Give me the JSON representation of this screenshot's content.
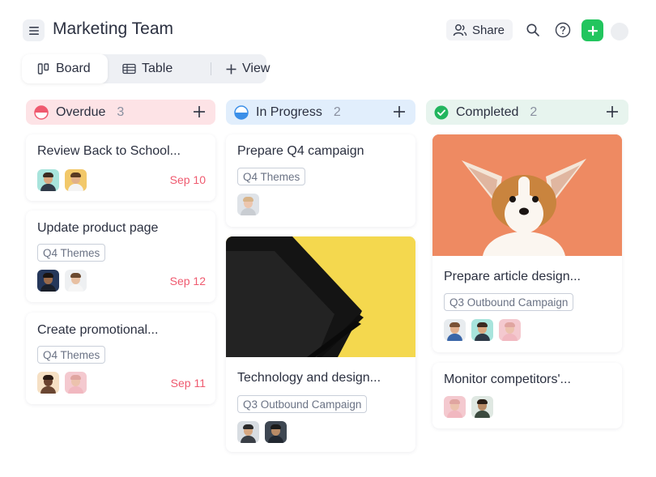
{
  "header": {
    "title": "Marketing Team",
    "share_label": "Share",
    "menu_icon": "hamburger-icon",
    "search_icon": "search-icon",
    "help_icon": "help-icon",
    "add_icon": "plus-icon"
  },
  "tabs": {
    "board": "Board",
    "table": "Table",
    "view": "View"
  },
  "columns": [
    {
      "name": "Overdue",
      "count": "3",
      "color": "#fde3e6",
      "accent": "#ef5a6f"
    },
    {
      "name": "In Progress",
      "count": "2",
      "color": "#e1eefc",
      "accent": "#3b8fe8"
    },
    {
      "name": "Completed",
      "count": "2",
      "color": "#e7f4ee",
      "accent": "#22b55e"
    }
  ],
  "cards": {
    "overdue": [
      {
        "title": "Review Back to School...",
        "date": "Sep 10"
      },
      {
        "title": "Update product page",
        "tag": "Q4 Themes",
        "date": "Sep 12"
      },
      {
        "title": "Create promotional...",
        "tag": "Q4 Themes",
        "date": "Sep 11"
      }
    ],
    "in_progress": [
      {
        "title": "Prepare Q4 campaign",
        "tag": "Q4 Themes"
      },
      {
        "title": "Technology and design...",
        "tag": "Q3 Outbound Campaign"
      }
    ],
    "completed": [
      {
        "title": "Prepare article design...",
        "tag": "Q3 Outbound Campaign"
      },
      {
        "title": "Monitor competitors'..."
      }
    ]
  },
  "colors": {
    "accent_green": "#22c55e",
    "date_red": "#ef5a6f",
    "text": "#2b3040"
  }
}
